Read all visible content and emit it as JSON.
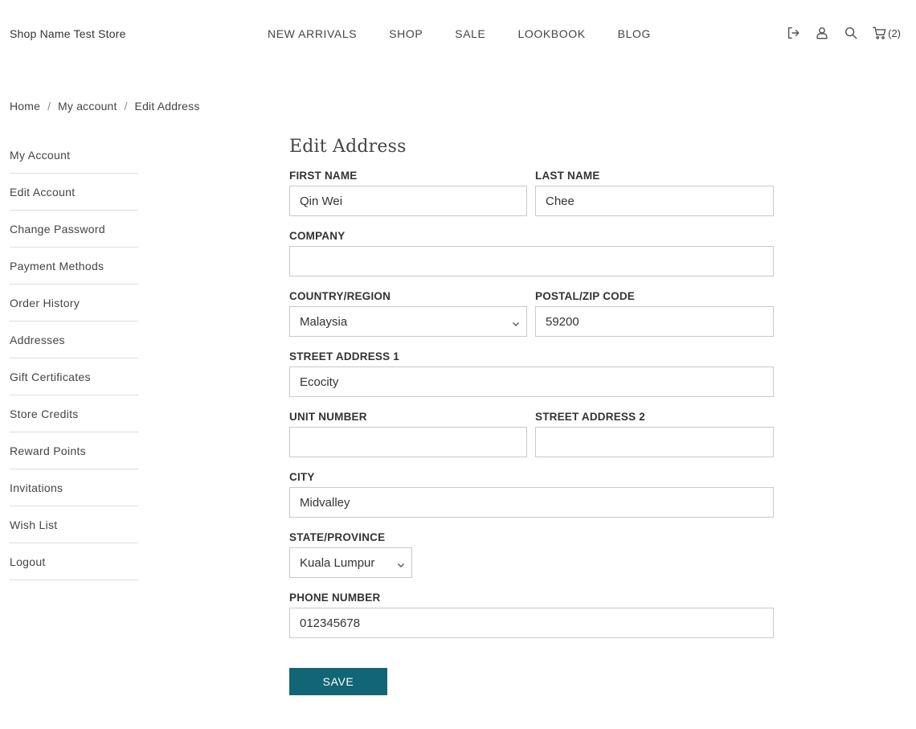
{
  "header": {
    "store_name": "Shop Name Test Store",
    "nav": [
      "NEW ARRIVALS",
      "SHOP",
      "SALE",
      "LOOKBOOK",
      "BLOG"
    ],
    "cart_count": "(2)"
  },
  "breadcrumb": [
    "Home",
    "My account",
    "Edit Address"
  ],
  "breadcrumb_separator": "/",
  "sidebar": {
    "items": [
      "My Account",
      "Edit Account",
      "Change Password",
      "Payment Methods",
      "Order History",
      "Addresses",
      "Gift Certificates",
      "Store Credits",
      "Reward Points",
      "Invitations",
      "Wish List",
      "Logout"
    ]
  },
  "form": {
    "title": "Edit Address",
    "first_name": {
      "label": "FIRST NAME",
      "value": "Qin Wei"
    },
    "last_name": {
      "label": "LAST NAME",
      "value": "Chee"
    },
    "company": {
      "label": "COMPANY",
      "value": ""
    },
    "country": {
      "label": "COUNTRY/REGION",
      "value": "Malaysia"
    },
    "postal": {
      "label": "POSTAL/ZIP CODE",
      "value": "59200"
    },
    "street1": {
      "label": "STREET ADDRESS 1",
      "value": "Ecocity"
    },
    "unit": {
      "label": "UNIT NUMBER",
      "value": ""
    },
    "street2": {
      "label": "STREET ADDRESS 2",
      "value": ""
    },
    "city": {
      "label": "CITY",
      "value": "Midvalley"
    },
    "state": {
      "label": "STATE/PROVINCE",
      "value": "Kuala Lumpur"
    },
    "phone": {
      "label": "PHONE NUMBER",
      "value": "012345678"
    },
    "save_label": "SAVE"
  },
  "colors": {
    "save_button": "#126575",
    "border": "#c9c9c9"
  }
}
